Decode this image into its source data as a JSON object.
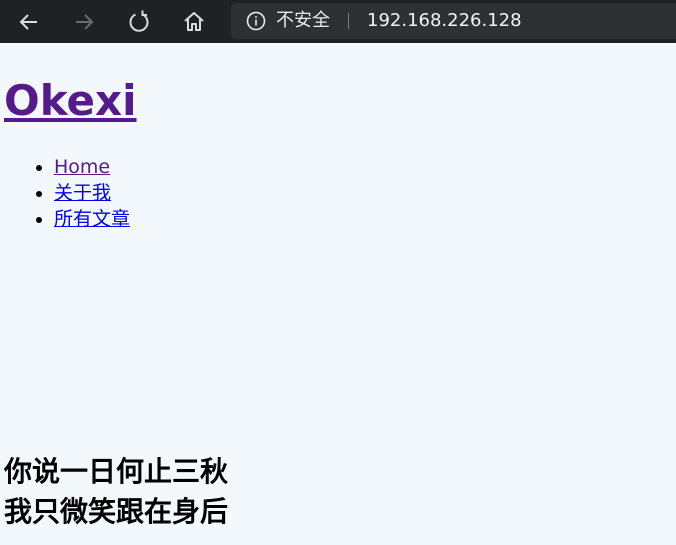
{
  "browser": {
    "back_icon": "arrow-left",
    "forward_icon": "arrow-right",
    "refresh_icon": "refresh",
    "home_icon": "home",
    "security_icon": "info-circle",
    "security_label": "不安全",
    "url": "192.168.226.128"
  },
  "page": {
    "site_title": "Okexi",
    "nav": [
      {
        "label": "Home"
      },
      {
        "label": "关于我"
      },
      {
        "label": "所有文章"
      }
    ],
    "poem": [
      "你说一日何止三秋",
      "我只微笑跟在身后"
    ]
  },
  "colors": {
    "toolbar_bg": "#202124",
    "page_bg": "#f2f8fc",
    "visited_link": "#551a8b",
    "link": "#0000ee"
  }
}
